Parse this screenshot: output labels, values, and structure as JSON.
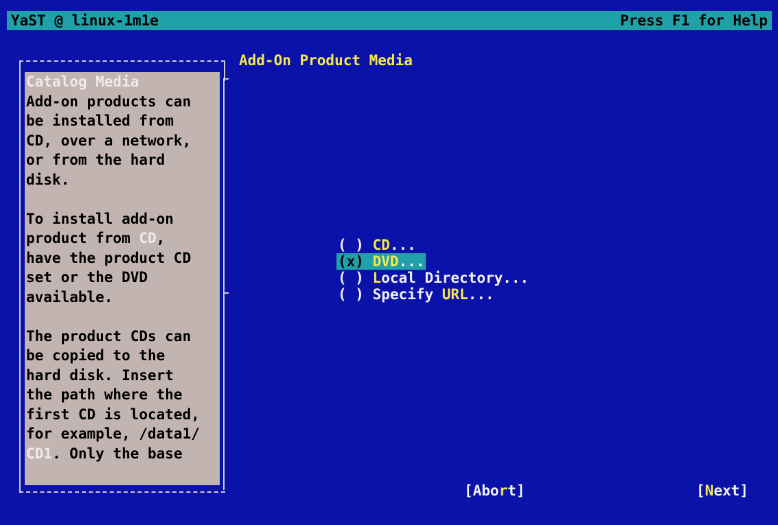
{
  "titlebar": {
    "left": "YaST @ linux-1m1e",
    "right": "Press F1 for Help"
  },
  "dialog": {
    "title": "Add-On Product Media"
  },
  "help": {
    "lines": [
      {
        "text": "Catalog Media",
        "dim": true
      },
      {
        "text": "Add-on products can"
      },
      {
        "text": "be installed from"
      },
      {
        "text": "CD, over a network,"
      },
      {
        "text": "or from the hard"
      },
      {
        "text": "disk."
      },
      {
        "text": ""
      },
      {
        "text": "To install add-on"
      },
      {
        "parts": [
          {
            "t": "product from "
          },
          {
            "t": "CD",
            "dim": true
          },
          {
            "t": ","
          }
        ]
      },
      {
        "text": "have the product CD"
      },
      {
        "text": "set or the DVD"
      },
      {
        "text": "available."
      },
      {
        "text": ""
      },
      {
        "text": "The product CDs can"
      },
      {
        "text": "be copied to the"
      },
      {
        "text": "hard disk. Insert"
      },
      {
        "text": "the path where the"
      },
      {
        "text": "first CD is located,"
      },
      {
        "text": "for example, /data1/"
      },
      {
        "parts": [
          {
            "t": "CD1",
            "dim": true
          },
          {
            "t": ". Only the base"
          }
        ]
      }
    ]
  },
  "options": [
    {
      "mark": "( )",
      "hot": "CD",
      "rest": "...",
      "selected": false,
      "name": "option-cd"
    },
    {
      "mark": "(x)",
      "hot": "DVD",
      "rest": "...",
      "selected": true,
      "name": "option-dvd"
    },
    {
      "mark": "( )",
      "hot": "L",
      "rest": "ocal Directory...",
      "selected": false,
      "name": "option-local-directory"
    },
    {
      "mark": "( )",
      "pre": "Specify ",
      "hot": "URL",
      "rest": "...",
      "selected": false,
      "name": "option-specify-url"
    }
  ],
  "buttons": {
    "abort": {
      "open": "[Abo",
      "hot": "r",
      "close": "t]"
    },
    "next": {
      "open": "[",
      "hot": "N",
      "close": "ext]"
    }
  }
}
